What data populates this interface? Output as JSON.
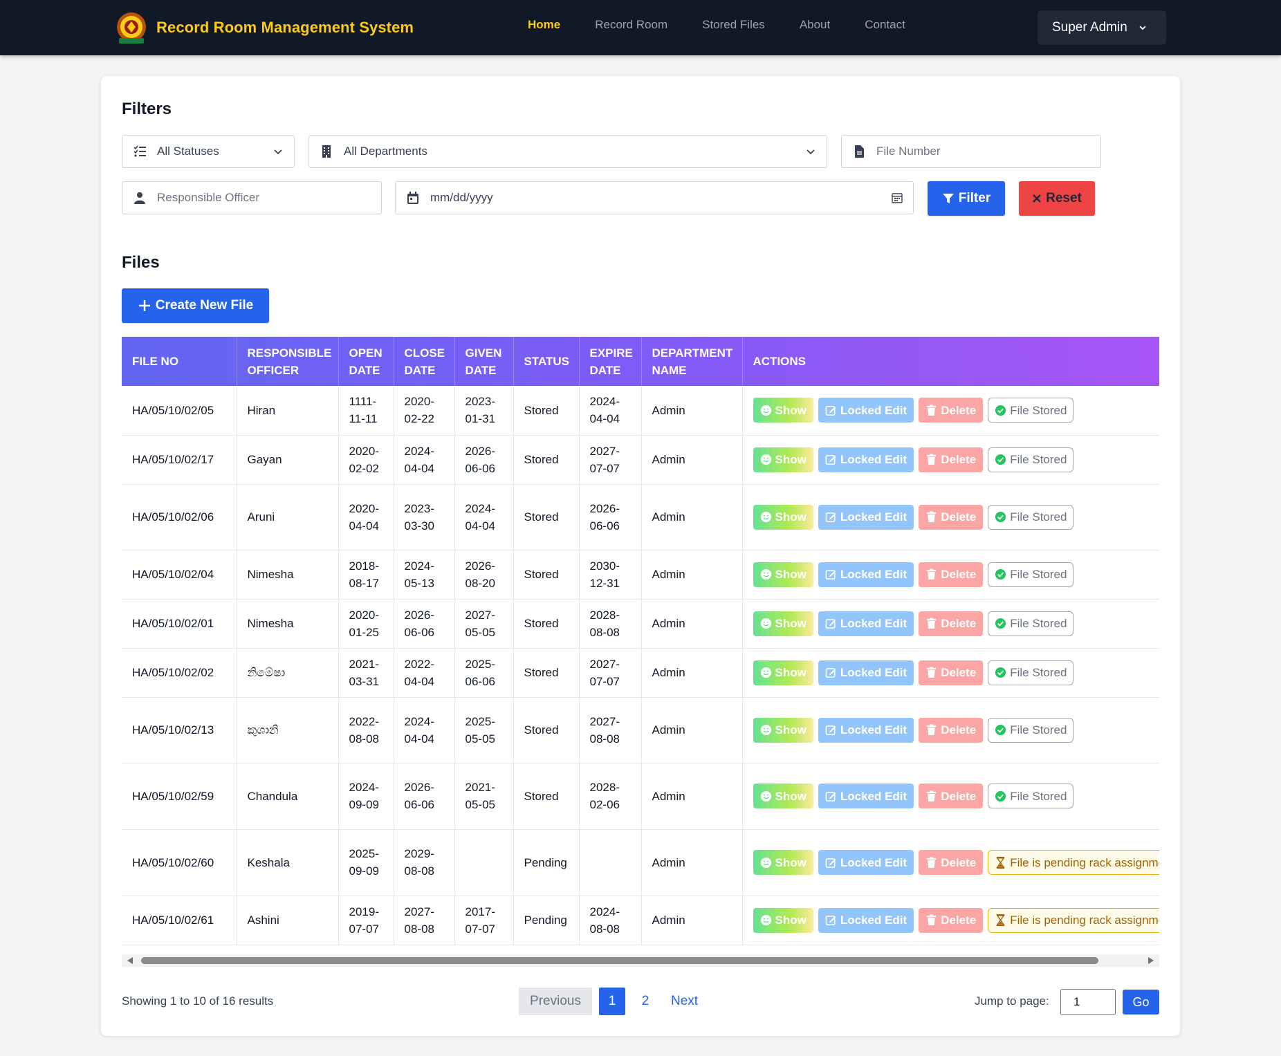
{
  "app": {
    "title": "Record Room Management System"
  },
  "nav": {
    "links": [
      {
        "label": "Home",
        "active": true
      },
      {
        "label": "Record Room",
        "active": false
      },
      {
        "label": "Stored Files",
        "active": false
      },
      {
        "label": "About",
        "active": false
      },
      {
        "label": "Contact",
        "active": false
      }
    ],
    "user": "Super Admin"
  },
  "filters": {
    "title": "Filters",
    "status": {
      "value": "All Statuses",
      "icon": "list-check-icon"
    },
    "department": {
      "value": "All Departments",
      "icon": "building-icon"
    },
    "file_number": {
      "placeholder": "File Number",
      "icon": "file-icon"
    },
    "officer": {
      "placeholder": "Responsible Officer",
      "icon": "user-icon"
    },
    "date": {
      "placeholder": "mm/dd/yyyy",
      "icon": "calendar-icon"
    },
    "filter_label": "Filter",
    "reset_label": "Reset"
  },
  "files": {
    "title": "Files",
    "create_label": "Create New File",
    "columns": [
      "FILE NO",
      "RESPONSIBLE OFFICER",
      "OPEN DATE",
      "CLOSE DATE",
      "GIVEN DATE",
      "STATUS",
      "EXPIRE DATE",
      "DEPARTMENT NAME",
      "ACTIONS"
    ],
    "action_labels": {
      "show": "Show",
      "edit": "Locked Edit",
      "delete": "Delete"
    },
    "rows": [
      {
        "file_no": "HA/05/10/02/05",
        "officer": "Hiran",
        "open": "1111-11-11",
        "close": "2020-02-22",
        "given": "2023-01-31",
        "status": "Stored",
        "expire": "2024-04-04",
        "dept": "Admin",
        "state_label": "File Stored",
        "state": "stored"
      },
      {
        "file_no": "HA/05/10/02/17",
        "officer": "Gayan",
        "open": "2020-02-02",
        "close": "2024-04-04",
        "given": "2026-06-06",
        "status": "Stored",
        "expire": "2027-07-07",
        "dept": "Admin",
        "state_label": "File Stored",
        "state": "stored"
      },
      {
        "file_no": "HA/05/10/02/06",
        "officer": "Aruni",
        "open": "2020-04-04",
        "close": "2023-03-30",
        "given": "2024-04-04",
        "status": "Stored",
        "expire": "2026-06-06",
        "dept": "Admin",
        "state_label": "File Stored",
        "state": "stored"
      },
      {
        "file_no": "HA/05/10/02/04",
        "officer": "Nimesha",
        "open": "2018-08-17",
        "close": "2024-05-13",
        "given": "2026-08-20",
        "status": "Stored",
        "expire": "2030-12-31",
        "dept": "Admin",
        "state_label": "File Stored",
        "state": "stored"
      },
      {
        "file_no": "HA/05/10/02/01",
        "officer": "Nimesha",
        "open": "2020-01-25",
        "close": "2026-06-06",
        "given": "2027-05-05",
        "status": "Stored",
        "expire": "2028-08-08",
        "dept": "Admin",
        "state_label": "File Stored",
        "state": "stored"
      },
      {
        "file_no": "HA/05/10/02/02",
        "officer": "නිමේෂා",
        "open": "2021-03-31",
        "close": "2022-04-04",
        "given": "2025-06-06",
        "status": "Stored",
        "expire": "2027-07-07",
        "dept": "Admin",
        "state_label": "File Stored",
        "state": "stored"
      },
      {
        "file_no": "HA/05/10/02/13",
        "officer": "කුශානි",
        "open": "2022-08-08",
        "close": "2024-04-04",
        "given": "2025-05-05",
        "status": "Stored",
        "expire": "2027-08-08",
        "dept": "Admin",
        "state_label": "File Stored",
        "state": "stored"
      },
      {
        "file_no": "HA/05/10/02/59",
        "officer": "Chandula",
        "open": "2024-09-09",
        "close": "2026-06-06",
        "given": "2021-05-05",
        "status": "Stored",
        "expire": "2028-02-06",
        "dept": "Admin",
        "state_label": "File Stored",
        "state": "stored"
      },
      {
        "file_no": "HA/05/10/02/60",
        "officer": "Keshala",
        "open": "2025-09-09",
        "close": "2029-08-08",
        "given": "",
        "status": "Pending",
        "expire": "",
        "dept": "Admin",
        "state_label": "File is pending rack assignment",
        "state": "pending"
      },
      {
        "file_no": "HA/05/10/02/61",
        "officer": "Ashini",
        "open": "2019-07-07",
        "close": "2027-08-08",
        "given": "2017-07-07",
        "status": "Pending",
        "expire": "2024-08-08",
        "dept": "Admin",
        "state_label": "File is pending rack assignment",
        "state": "pending"
      }
    ]
  },
  "pagination": {
    "showing": "Showing 1 to 10 of 16 results",
    "previous": "Previous",
    "pages": [
      "1",
      "2"
    ],
    "current": "1",
    "next": "Next",
    "jump_label": "Jump to page:",
    "jump_value": "1",
    "go": "Go"
  },
  "colors": {
    "nav_bg": "#111827",
    "brand": "#facc15",
    "primary": "#2563eb",
    "danger": "#ef4444",
    "header_from": "#6366f1",
    "header_to": "#a855f7"
  }
}
